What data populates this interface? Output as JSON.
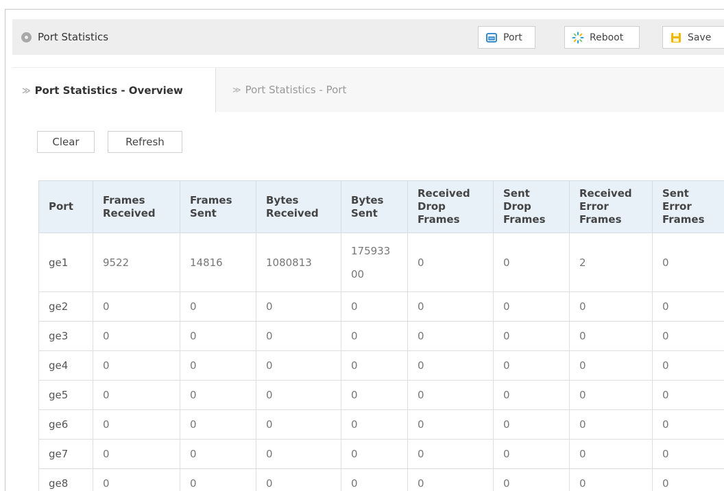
{
  "header": {
    "title": "Port Statistics",
    "buttons": {
      "port": "Port",
      "reboot": "Reboot",
      "save": "Save"
    }
  },
  "tabs": [
    {
      "label": "Port Statistics - Overview",
      "active": true
    },
    {
      "label": "Port Statistics - Port",
      "active": false
    }
  ],
  "actions": {
    "clear": "Clear",
    "refresh": "Refresh"
  },
  "table": {
    "headers": [
      [
        "Port"
      ],
      [
        "Frames",
        "Received"
      ],
      [
        "Frames",
        "Sent"
      ],
      [
        "Bytes",
        "Received"
      ],
      [
        "Bytes",
        "Sent"
      ],
      [
        "Received",
        "Drop",
        "Frames"
      ],
      [
        "Sent",
        "Drop",
        "Frames"
      ],
      [
        "Received",
        "Error",
        "Frames"
      ],
      [
        "Sent",
        "Error",
        "Frames"
      ]
    ],
    "rows": [
      [
        "ge1",
        "9522",
        "14816",
        "1080813",
        "17593300",
        "0",
        "0",
        "2",
        "0"
      ],
      [
        "ge2",
        "0",
        "0",
        "0",
        "0",
        "0",
        "0",
        "0",
        "0"
      ],
      [
        "ge3",
        "0",
        "0",
        "0",
        "0",
        "0",
        "0",
        "0",
        "0"
      ],
      [
        "ge4",
        "0",
        "0",
        "0",
        "0",
        "0",
        "0",
        "0",
        "0"
      ],
      [
        "ge5",
        "0",
        "0",
        "0",
        "0",
        "0",
        "0",
        "0",
        "0"
      ],
      [
        "ge6",
        "0",
        "0",
        "0",
        "0",
        "0",
        "0",
        "0",
        "0"
      ],
      [
        "ge7",
        "0",
        "0",
        "0",
        "0",
        "0",
        "0",
        "0",
        "0"
      ],
      [
        "ge8",
        "0",
        "0",
        "0",
        "0",
        "0",
        "0",
        "0",
        "0"
      ]
    ]
  },
  "colors": {
    "header_bg": "#eeeeee",
    "table_header_bg": "#e8f1f8",
    "port_icon": "#1e7fc8",
    "reboot_icon": "#2aa0d8",
    "save_icon": "#f2b705"
  },
  "icons": {
    "title": "circle-bullet-icon",
    "port": "switch-icon",
    "reboot": "reboot-spinner-icon",
    "save": "save-floppy-icon",
    "tab": "chevron-right-icon"
  }
}
